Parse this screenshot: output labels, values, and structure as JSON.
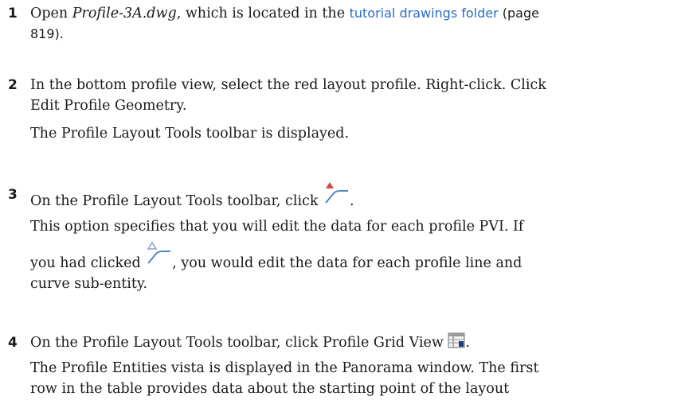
{
  "steps": [
    {
      "num": "1",
      "before": "Open ",
      "file": "Profile-3A.dwg",
      "middle": ", which is located in the ",
      "link": "tutorial drawings folder",
      "page_ref": " (page",
      "page_ref2": "819)."
    },
    {
      "num": "2",
      "line1": "In the bottom profile view, select the red layout profile. Right-click. Click",
      "line2": "Edit Profile Geometry.",
      "result": "The Profile Layout Tools toolbar is displayed."
    },
    {
      "num": "3",
      "text": "On the Profile Layout Tools toolbar, click",
      "end": ".",
      "desc1": "This option specifies that you will edit the data for each profile PVI. If",
      "desc2a": "you had clicked",
      "desc2b": ", you would edit the data for each profile line and",
      "desc3": "curve sub-entity.",
      "icon_pvi": "pvi-based-icon",
      "icon_entity": "entity-based-icon"
    },
    {
      "num": "4",
      "text": "On the Profile Layout Tools toolbar, click Profile Grid View",
      "end": ".",
      "desc1": "The Profile Entities vista is displayed in the Panorama window. The first",
      "desc2": "row in the table provides data about the starting point of the layout",
      "icon_grid": "profile-grid-view-icon"
    }
  ],
  "colors": {
    "link": "#2a6cc2",
    "pvi_marker": "#d64545",
    "entity_marker": "#8aa0c8",
    "curve": "#4a86c8"
  }
}
